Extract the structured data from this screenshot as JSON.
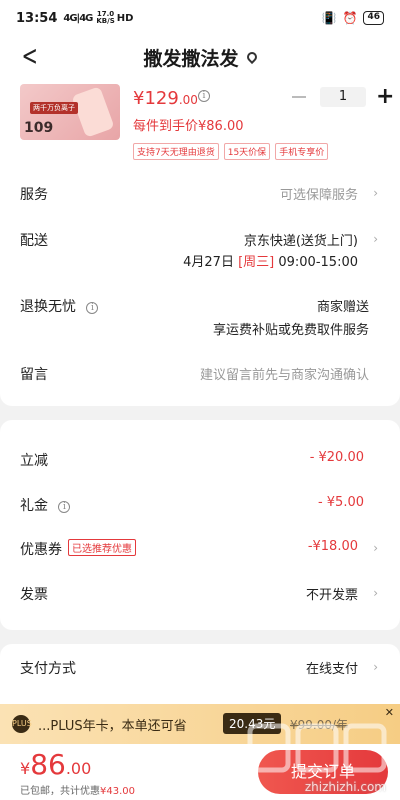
{
  "status_bar": {
    "time": "13:54",
    "signal": "4G|4G",
    "net_speed_value": "17.0",
    "net_speed_unit": "KB/S",
    "hd": "HD",
    "battery": "46"
  },
  "nav": {
    "title": "撒发撒法发"
  },
  "product": {
    "price_currency": "¥",
    "price_int": "129",
    "price_dec": ".00",
    "quantity": "1",
    "hand_price": "每件到手价¥86.00",
    "image_badge": "两千万负离子",
    "image_price": "109",
    "tags": [
      "支持7天无理由退货",
      "15天价保",
      "手机专享价"
    ]
  },
  "service": {
    "label": "服务",
    "value": "可选保障服务"
  },
  "delivery": {
    "label": "配送",
    "value": "京东快递(送货上门)",
    "date_pre": "4月27日 ",
    "date_day": "[周三]",
    "date_time": " 09:00-15:00"
  },
  "return": {
    "label": "退换无忧",
    "line1": "商家赠送",
    "line2": "享运费补贴或免费取件服务"
  },
  "note": {
    "label": "留言",
    "placeholder": "建议留言前先与商家沟通确认"
  },
  "discounts": {
    "instant": {
      "label": "立减",
      "value": "- ¥20.00"
    },
    "gift": {
      "label": "礼金",
      "value": "- ¥5.00"
    },
    "coupon": {
      "label": "优惠券",
      "tag": "已选推荐优惠",
      "value": "-¥18.00"
    },
    "invoice": {
      "label": "发票",
      "value": "不开发票"
    }
  },
  "payment": {
    "label": "支付方式",
    "value": "在线支付"
  },
  "plus_banner": {
    "logo": "PLUS",
    "text": "...PLUS年卡，本单还可省",
    "button": "20.43元",
    "old_price": "¥99.00/年",
    "close": "✕"
  },
  "footer": {
    "total_currency": "¥",
    "total_int": "86",
    "total_dec": ".00",
    "shipping": "已包邮",
    "saved": "，共计优惠",
    "saved_amount": "¥43.00",
    "submit": "提交订单"
  },
  "watermark": {
    "text": "zhizhizhi.com"
  },
  "colors": {
    "accent": "#e4393c",
    "plus_gold": "#f6cd84",
    "plus_dark": "#3a2b14",
    "background": "#f2f2f2"
  }
}
